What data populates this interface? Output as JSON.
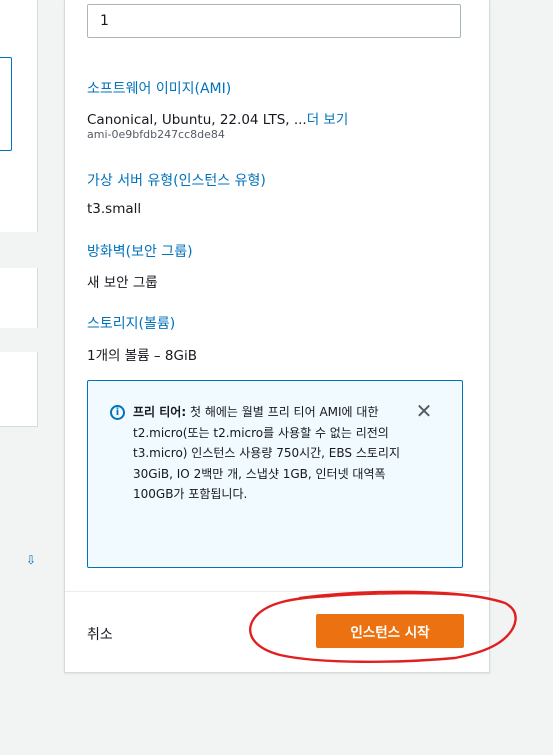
{
  "instances": {
    "count_value": "1"
  },
  "ami": {
    "title": "소프트웨어 이미지(AMI)",
    "description": "Canonical, Ubuntu, 22.04 LTS, ...",
    "more_link": "더 보기",
    "ami_id": "ami-0e9bfdb247cc8de84"
  },
  "instance_type": {
    "title": "가상 서버 유형(인스턴스 유형)",
    "value": "t3.small"
  },
  "firewall": {
    "title": "방화벽(보안 그룹)",
    "value": "새 보안 그룹"
  },
  "storage": {
    "title": "스토리지(볼륨)",
    "value": "1개의 볼륨 – 8GiB"
  },
  "free_tier": {
    "label": "프리 티어:",
    "text": "첫 해에는 월별 프리 티어 AMI에 대한 t2.micro(또는 t2.micro를 사용할 수 없는 리전의 t3.micro) 인스턴스 사용량 750시간, EBS 스토리지 30GiB, IO 2백만 개, 스냅샷 1GB, 인터넷 대역폭 100GB가 포함됩니다.",
    "icon": "info-icon",
    "close_icon": "close-icon"
  },
  "footer": {
    "cancel_label": "취소",
    "launch_label": "인스턴스 시작"
  },
  "colors": {
    "accent": "#0073bb",
    "primary_button": "#ec7211",
    "annotation": "#e0201e",
    "info_bg": "#f1faff"
  }
}
